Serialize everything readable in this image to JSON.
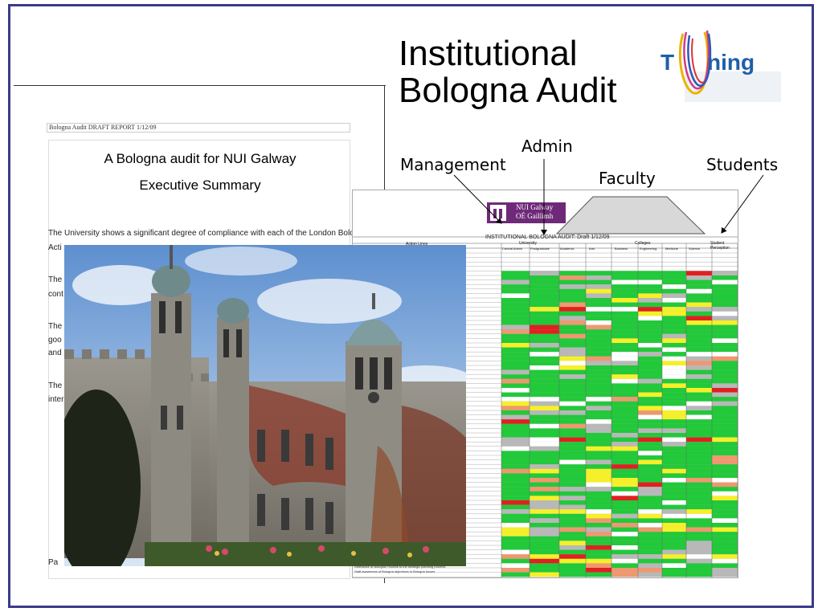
{
  "slide": {
    "title_line1": "Institutional",
    "title_line2": "Bologna Audit"
  },
  "logo": {
    "text_left": "T",
    "text_right": "ning",
    "color": "#1f5fa8"
  },
  "annotations": {
    "admin": "Admin",
    "management": "Management",
    "faculty": "Faculty",
    "students": "Students"
  },
  "document": {
    "header": "Bologna Audit DRAFT REPORT 1/12/09",
    "title": "A Bologna audit for NUI Galway",
    "subtitle": "Executive Summary",
    "paragraph1": "The University shows a significant degree of compliance with each of the London Bologna",
    "fragments": [
      "Acti",
      "The",
      "cont",
      "The",
      "goo",
      "and",
      "The",
      "inter",
      "Pa"
    ]
  },
  "spreadsheet": {
    "logo_line1": "NUI Galway",
    "logo_line2": "OÉ Gaillimh",
    "title": "INSTITUTIONAL BOLOGNA AUDIT: Draft 1/12/09",
    "group_university": "University",
    "group_colleges": "Colleges",
    "group_students": "Student Perception",
    "columns": [
      "Central Admin",
      "Postgraduate",
      "Academic",
      "Arts",
      "Business",
      "Engineering",
      "Medicine",
      "Science"
    ],
    "left_header": "Action Lines",
    "footnote1": "Relevance of Bologna Process to the strategic planning process",
    "footnote2": "Staff awareness of Bologna objectives in Bologna issues",
    "colors": {
      "green": "#22c93a",
      "yellow": "#f5f02a",
      "red": "#e02020",
      "salmon": "#ef9870",
      "grey": "#b8b8b8"
    }
  }
}
